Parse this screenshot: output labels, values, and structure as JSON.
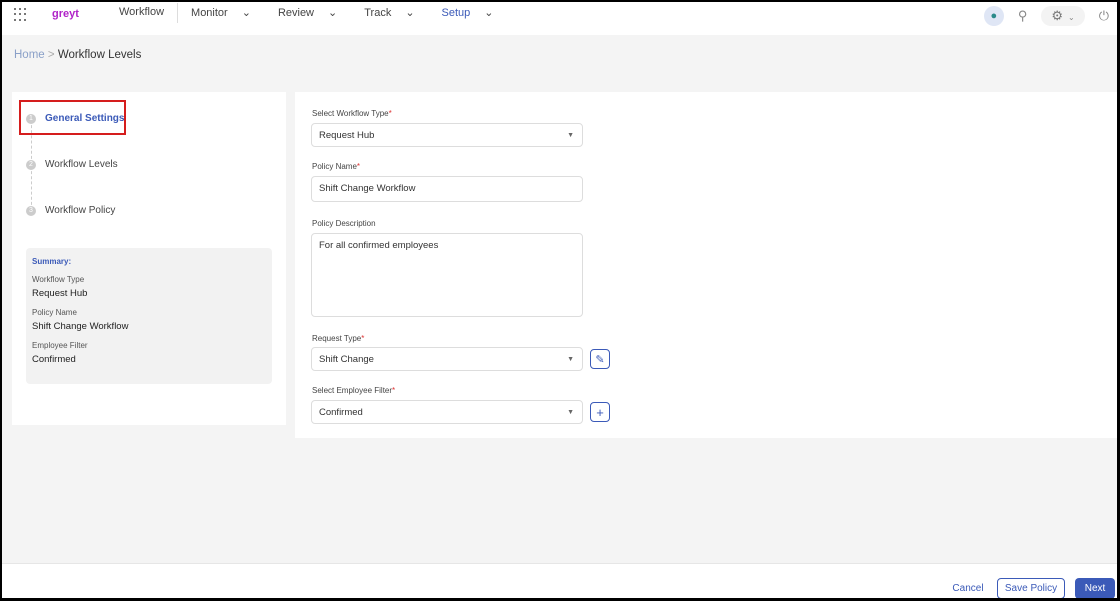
{
  "topbar": {
    "logo": "greyt",
    "nav": [
      "Workflow",
      "Monitor",
      "Review",
      "Track",
      "Setup"
    ]
  },
  "breadcrumb": {
    "home": "Home",
    "sep": ">",
    "current": "Workflow Levels"
  },
  "steps": [
    {
      "num": "1",
      "label": "General Settings"
    },
    {
      "num": "2",
      "label": "Workflow Levels"
    },
    {
      "num": "3",
      "label": "Workflow Policy"
    }
  ],
  "summary": {
    "title": "Summary:",
    "items": [
      {
        "k": "Workflow Type",
        "v": "Request Hub"
      },
      {
        "k": "Policy Name",
        "v": "Shift Change Workflow"
      },
      {
        "k": "Employee Filter",
        "v": "Confirmed"
      }
    ]
  },
  "form": {
    "workflow_type": {
      "label": "Select Workflow Type",
      "value": "Request Hub"
    },
    "policy_name": {
      "label": "Policy Name",
      "value": "Shift Change Workflow"
    },
    "policy_description": {
      "label": "Policy Description",
      "value": "For all confirmed employees"
    },
    "request_type": {
      "label": "Request Type",
      "value": "Shift Change"
    },
    "employee_filter": {
      "label": "Select Employee Filter",
      "value": "Confirmed"
    },
    "required_mark": "*"
  },
  "footer": {
    "cancel": "Cancel",
    "save": "Save Policy",
    "next": "Next"
  }
}
